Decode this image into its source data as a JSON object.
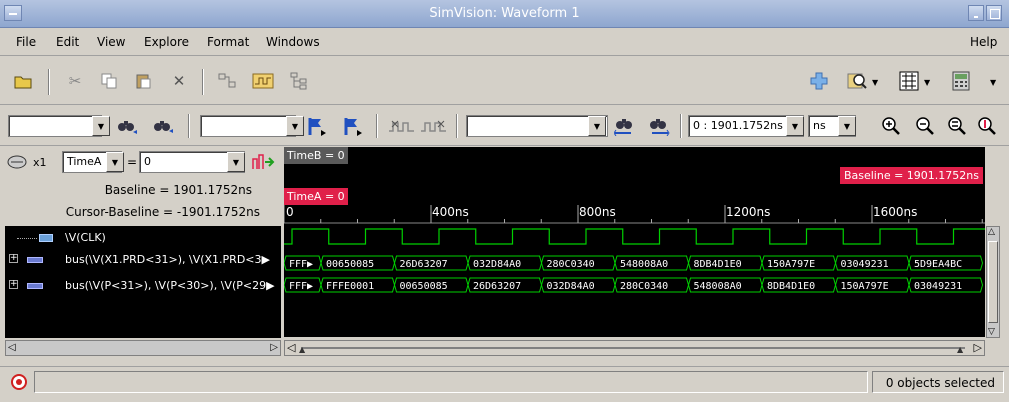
{
  "window": {
    "title": "SimVision: Waveform 1"
  },
  "menu": {
    "file": "File",
    "edit": "Edit",
    "view": "View",
    "explore": "Explore",
    "format": "Format",
    "windows": "Windows",
    "help": "Help"
  },
  "cursor": {
    "zoom_label": "x1",
    "time_selector": "TimeA",
    "equals": "=",
    "value": "0",
    "baseline_text": "Baseline = 1901.1752ns",
    "cursor_baseline_text": "Cursor-Baseline = -1901.1752ns"
  },
  "time_range": {
    "value": "0 : 1901.1752ns",
    "unit": "ns"
  },
  "markers": {
    "timeB": "TimeB = 0",
    "timeA": "TimeA = 0",
    "baseline": "Baseline = 1901.1752ns"
  },
  "ruler": {
    "labels": [
      "0",
      "400ns",
      "800ns",
      "1200ns",
      "1600ns"
    ]
  },
  "signals": [
    {
      "name": "\\V(CLK)",
      "type": "logic"
    },
    {
      "name": "bus(\\V(X1.PRD<31>), \\V(X1.PRD<3▶",
      "type": "bus"
    },
    {
      "name": "bus(\\V(P<31>), \\V(P<30>), \\V(P<29▶",
      "type": "bus"
    }
  ],
  "bus_values": {
    "row1": [
      "FFF▶",
      "00650085",
      "26D63207",
      "032D84A0",
      "280C0340",
      "548008A0",
      "8DB4D1E0",
      "150A797E",
      "03049231",
      "5D9EA4BC"
    ],
    "row2": [
      "FFF▶",
      "FFFE0001",
      "00650085",
      "26D63207",
      "032D84A0",
      "280C0340",
      "548008A0",
      "8DB4D1E0",
      "150A797E",
      "03049231"
    ]
  },
  "status": {
    "text": "0 objects selected"
  },
  "colors": {
    "wave": "#00d000",
    "marker": "#e0204a",
    "background": "#000000"
  }
}
